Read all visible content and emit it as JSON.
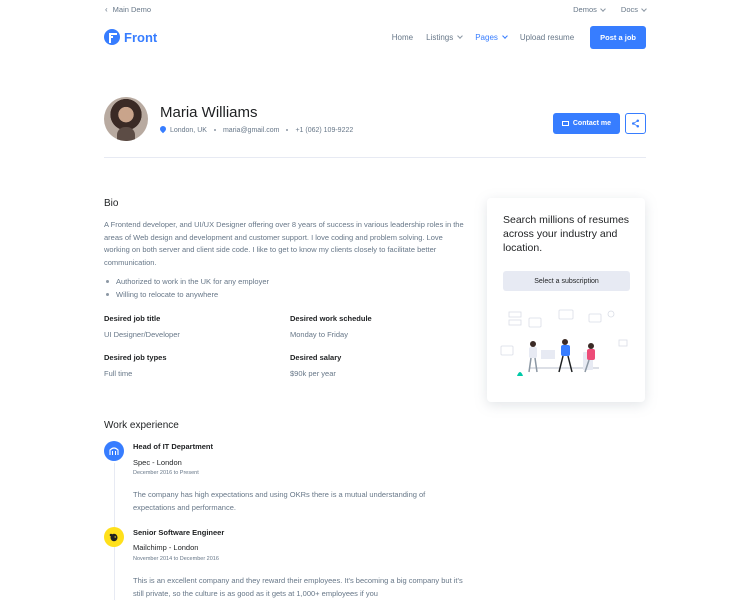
{
  "topbar": {
    "back_label": "Main Demo",
    "demos_label": "Demos",
    "docs_label": "Docs"
  },
  "navbar": {
    "brand": "Front",
    "links": [
      "Home",
      "Listings",
      "Pages",
      "Upload resume"
    ],
    "active_link": "Pages",
    "post_job_label": "Post a job"
  },
  "profile": {
    "name": "Maria Williams",
    "location": "London, UK",
    "email": "maria@gmail.com",
    "phone": "+1 (062) 109-9222",
    "contact_label": "Contact me"
  },
  "bio": {
    "title": "Bio",
    "text": "A Frontend developer, and UI/UX Designer offering over 8 years of success in various leadership roles in the areas of Web design and development and customer support. I love coding and problem solving. Love working on both server and client side code. I like to get to know my clients closely to facilitate better communication.",
    "bullets": [
      "Authorized to work in the UK for any employer",
      "Willing to relocate to anywhere"
    ],
    "fields": {
      "job_title_label": "Desired job title",
      "job_title_value": "UI Designer/Developer",
      "schedule_label": "Desired work schedule",
      "schedule_value": "Monday to Friday",
      "job_types_label": "Desired job types",
      "job_types_value": "Full time",
      "salary_label": "Desired salary",
      "salary_value": "$90k per year"
    }
  },
  "side_card": {
    "title": "Search millions of resumes across your industry and location.",
    "button_label": "Select a subscription"
  },
  "work": {
    "title": "Work experience",
    "jobs": [
      {
        "title": "Head of IT Department",
        "company": "Spec - London",
        "dates": "December 2016 to Present",
        "description": "The company has high expectations and using OKRs there is a mutual understanding of expectations and performance."
      },
      {
        "title": "Senior Software Engineer",
        "company": "Mailchimp - London",
        "dates": "November 2014 to December 2016",
        "description": "This is an excellent company and they reward their employees. It's becoming a big company but it's still private, so the culture is as good as it gets at 1,000+ employees if you"
      }
    ]
  },
  "colors": {
    "primary": "#377dff",
    "text_dark": "#1e2022",
    "text_muted": "#677788",
    "mailchimp_yellow": "#ffe01b"
  }
}
